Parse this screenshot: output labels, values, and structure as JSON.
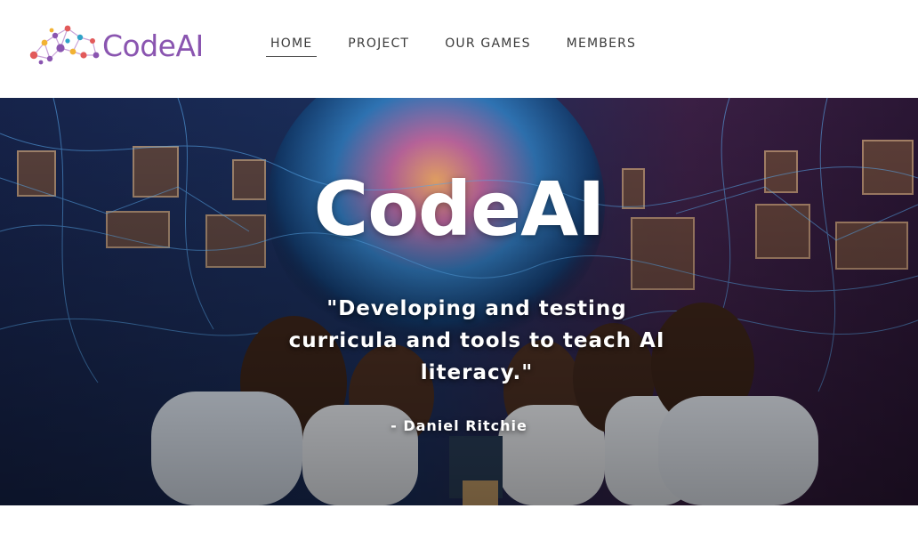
{
  "brand": {
    "name": "CodeAI",
    "text_color": "#8a55b0"
  },
  "nav": {
    "items": [
      {
        "label": "HOME",
        "active": true
      },
      {
        "label": "PROJECT",
        "active": false
      },
      {
        "label": "OUR GAMES",
        "active": false
      },
      {
        "label": "MEMBERS",
        "active": false
      }
    ]
  },
  "hero": {
    "title": "CodeAI",
    "quote": "\"Developing and testing curricula and tools to teach AI literacy.\"",
    "author": "- Daniel Ritchie",
    "image_description_icon": "students-ai-network-photo"
  }
}
